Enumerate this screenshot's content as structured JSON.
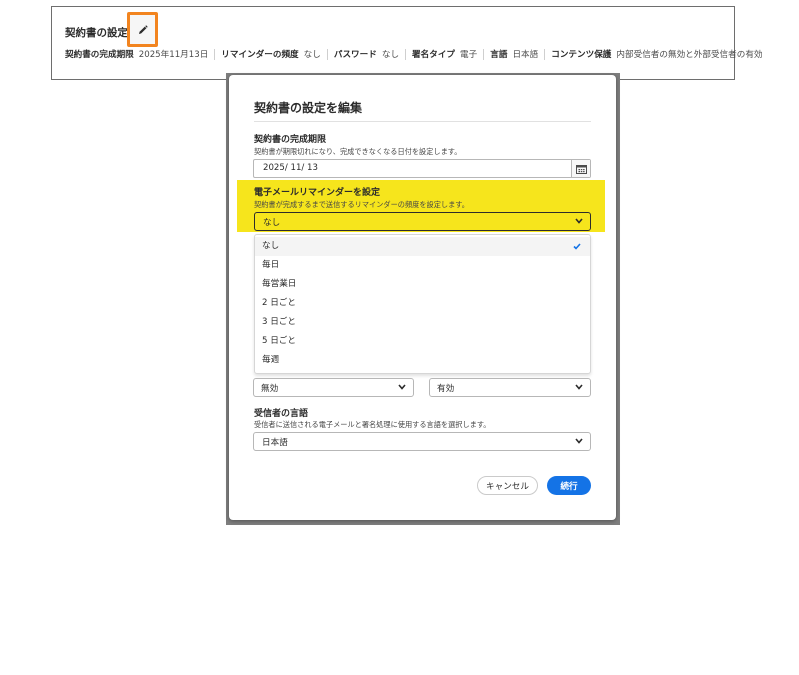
{
  "summary": {
    "title": "契約書の設定",
    "items": [
      {
        "label": "契約書の完成期限",
        "value": "2025年11月13日"
      },
      {
        "label": "リマインダーの頻度",
        "value": "なし"
      },
      {
        "label": "パスワード",
        "value": "なし"
      },
      {
        "label": "署名タイプ",
        "value": "電子"
      },
      {
        "label": "言語",
        "value": "日本語"
      },
      {
        "label": "コンテンツ保護",
        "value": "内部受信者の無効と外部受信者の有効"
      }
    ],
    "edit_icon": "pencil-icon",
    "edit_highlight_color": "#f2841f"
  },
  "modal": {
    "title": "契約書の設定を編集",
    "deadline": {
      "label": "契約書の完成期限",
      "description": "契約書が期限切れになり、完成できなくなる日付を設定します。",
      "value": "2025/  11/  13",
      "calendar_icon": "calendar-icon"
    },
    "reminder": {
      "label": "電子メールリマインダーを設定",
      "description": "契約書が完成するまで送信するリマインダーの頻度を設定します。",
      "selected": "なし",
      "highlight_color": "#f6e51c",
      "options": [
        "なし",
        "毎日",
        "毎営業日",
        "2 日ごと",
        "3 日ごと",
        "5 日ごと",
        "毎週"
      ]
    },
    "protection": {
      "internal_value": "無効",
      "external_value": "有効"
    },
    "language": {
      "label": "受信者の言語",
      "description": "受信者に送信される電子メールと署名処理に使用する言語を選択します。",
      "value": "日本語"
    },
    "buttons": {
      "cancel": "キャンセル",
      "continue": "続行"
    },
    "accent_color": "#1473e6"
  }
}
